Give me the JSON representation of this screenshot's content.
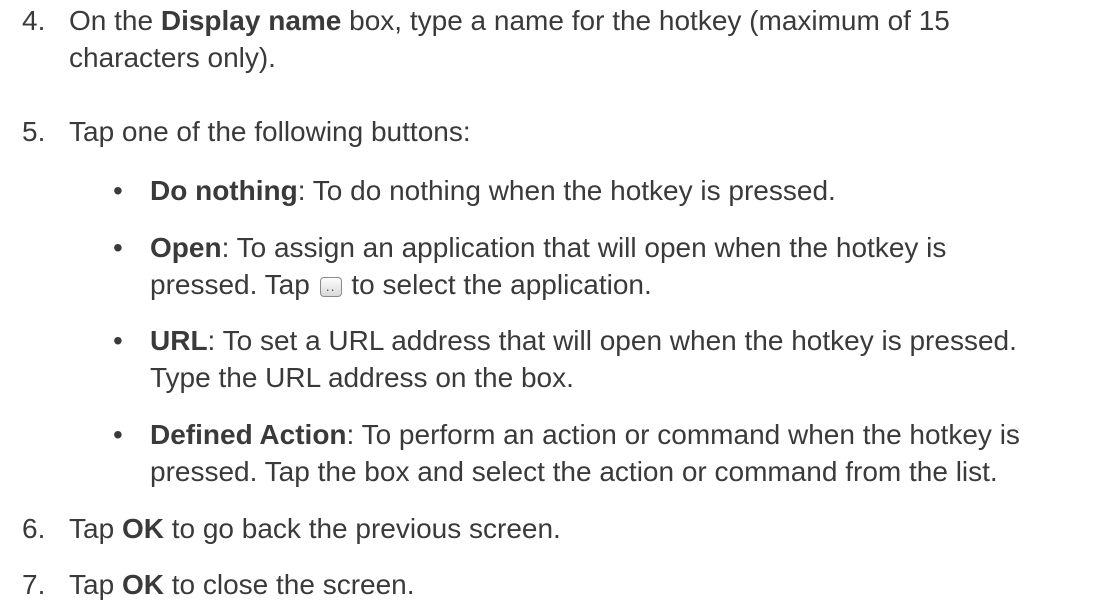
{
  "steps": [
    {
      "number": "4.",
      "lines": [
        {
          "pre": "On the ",
          "bold": "Display name",
          "post": " box, type a name for the hotkey (maximum of 15"
        },
        {
          "text": "characters only)."
        }
      ]
    },
    {
      "number": "5.",
      "text": "Tap one of the following buttons:",
      "bullets": [
        {
          "symbol": "•",
          "bold": "Do nothing",
          "line1": ": To do nothing when the hotkey is pressed."
        },
        {
          "symbol": "•",
          "bold": "Open",
          "line1": ": To assign an application that will open when the hotkey is",
          "line2_pre": "pressed. Tap ",
          "line2_icon": "browse-button-icon",
          "line2_post": " to select the application."
        },
        {
          "symbol": "•",
          "bold": "URL",
          "line1": ": To set a URL address that will open when the hotkey is pressed.",
          "line2": "Type the URL address on the box."
        },
        {
          "symbol": "•",
          "bold": "Defined Action",
          "line1": ": To perform an action or command when the hotkey is",
          "line2": "pressed. Tap the box and select the action or command from the list."
        }
      ]
    },
    {
      "number": "6.",
      "pre": "Tap ",
      "bold": "OK",
      "post": " to go back the previous screen."
    },
    {
      "number": "7.",
      "pre": "Tap ",
      "bold": "OK",
      "post": " to close the screen."
    }
  ]
}
